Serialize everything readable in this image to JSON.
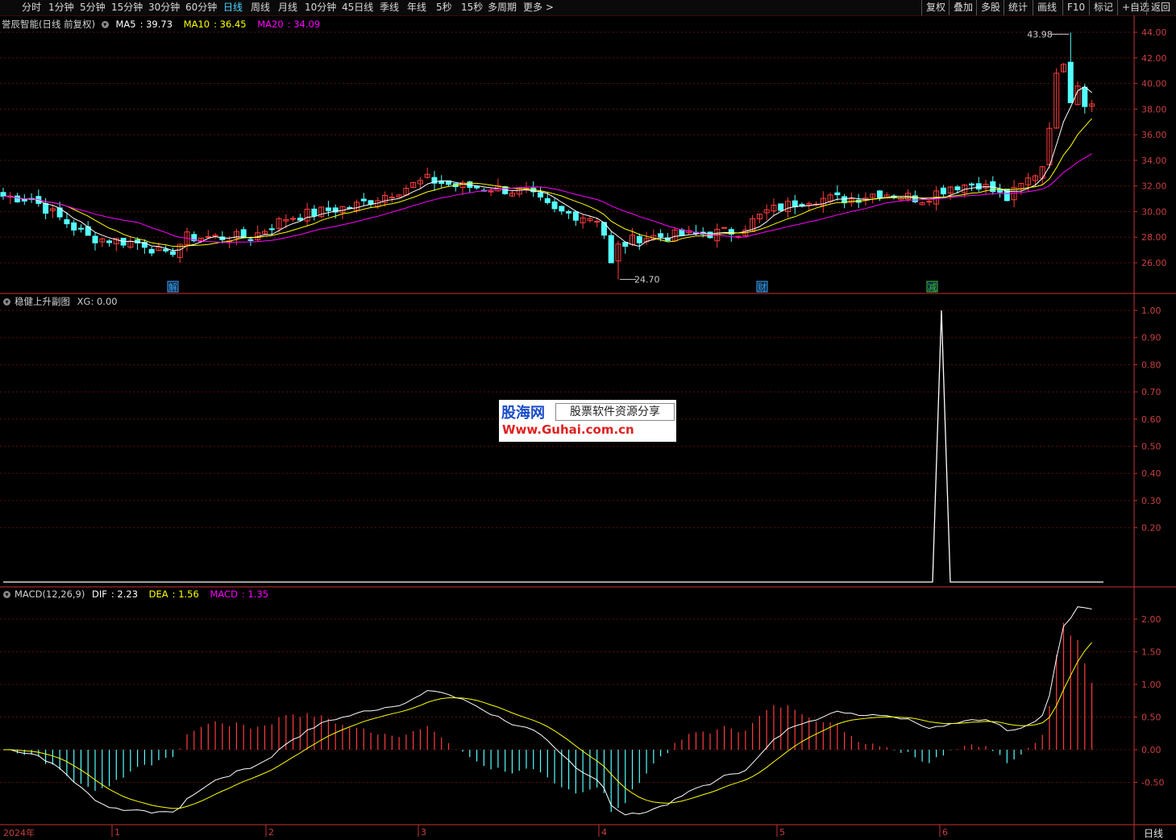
{
  "toolbar": {
    "periods": [
      "分时",
      "1分钟",
      "5分钟",
      "15分钟",
      "30分钟",
      "60分钟",
      "日线",
      "周线",
      "月线",
      "10分钟",
      "45日线",
      "季线",
      "年线",
      "5秒",
      "15秒",
      "多周期",
      "更多 >"
    ],
    "active": "日线",
    "right_buttons": [
      "复权",
      "叠加",
      "多股",
      "统计",
      "画线",
      "F10",
      "标记",
      "+自选",
      "返回"
    ]
  },
  "main_panel": {
    "stock_title": "誉辰智能(日线 前复权)",
    "ma_labels": [
      {
        "name": "MA5",
        "value": "39.73",
        "color": "#ffffff"
      },
      {
        "name": "MA10",
        "value": "36.45",
        "color": "#ffff00"
      },
      {
        "name": "MA20",
        "value": "34.09",
        "color": "#ff00ff"
      }
    ],
    "y_ticks": [
      "44.00",
      "42.00",
      "40.00",
      "38.00",
      "36.00",
      "34.00",
      "32.00",
      "30.00",
      "28.00",
      "26.00"
    ],
    "high_marker": "43.98",
    "low_marker": "24.70",
    "event_tags": [
      "解",
      "财",
      "减"
    ]
  },
  "indicator_panel": {
    "title": "稳健上升副图",
    "value_label": "XG: 0.00",
    "y_ticks": [
      "1.00",
      "0.90",
      "0.80",
      "0.70",
      "0.60",
      "0.50",
      "0.40",
      "0.30",
      "0.20"
    ]
  },
  "macd_panel": {
    "title": "MACD(12,26,9)",
    "labels": [
      {
        "name": "DIF",
        "value": "2.23",
        "color": "#ffffff"
      },
      {
        "name": "DEA",
        "value": "1.56",
        "color": "#ffff00"
      },
      {
        "name": "MACD",
        "value": "1.35",
        "color": "#ff00ff"
      }
    ],
    "y_ticks": [
      "2.00",
      "1.50",
      "1.00",
      "0.50",
      "0.00",
      "-0.50"
    ]
  },
  "x_axis": {
    "year_label": "2024年",
    "months": [
      "1",
      "2",
      "3",
      "4",
      "5",
      "6"
    ],
    "period_label": "日线"
  },
  "watermark": {
    "brand": "股海网",
    "tagline": "股票软件资源分享",
    "url": "Www.Guhai.com.cn"
  },
  "colors": {
    "up": "#ff3c3c",
    "down": "#54ffff",
    "ma5": "#ffffff",
    "ma10": "#ffff00",
    "ma20": "#ff00ff",
    "grid": "#5a1010",
    "axis": "#c83232"
  }
}
